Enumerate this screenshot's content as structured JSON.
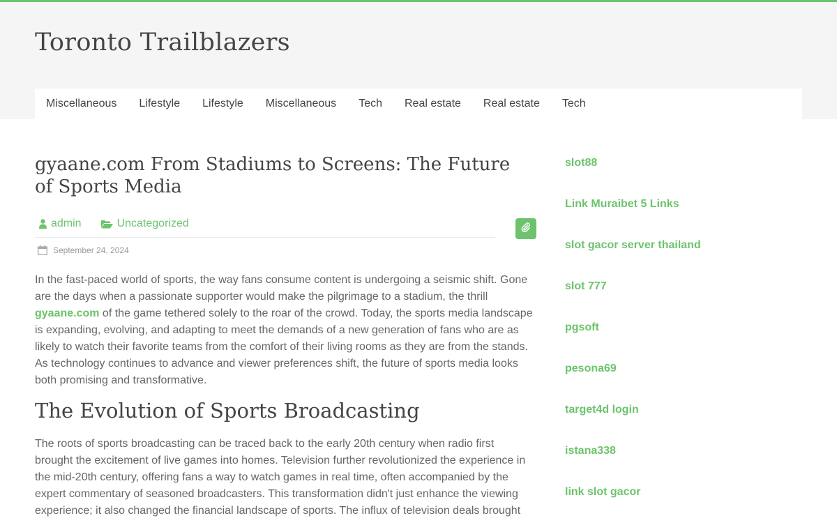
{
  "site": {
    "title": "Toronto Trailblazers"
  },
  "nav": {
    "items": [
      "Miscellaneous",
      "Lifestyle",
      "Lifestyle",
      "Miscellaneous",
      "Tech",
      "Real estate",
      "Real estate",
      "Tech"
    ]
  },
  "post": {
    "title": "gyaane.com From Stadiums to Screens: The Future of Sports Media",
    "author": "admin",
    "category": "Uncategorized",
    "date": "September 24, 2024",
    "para1_before": "In the fast-paced world of sports, the way fans consume content is undergoing a seismic shift. Gone are the days when a passionate supporter would make the pilgrimage to a stadium, the thrill ",
    "para1_link": "gyaane.com",
    "para1_after": " of the game tethered solely to the roar of the crowd. Today, the sports media landscape is expanding, evolving, and  adapting to meet the demands of a new generation of fans who are as likely to watch their favorite teams from the comfort of their living rooms as they are from the stands. As technology continues to advance and viewer preferences shift, the future of sports media looks both promising and transformative.",
    "heading2": "The Evolution of Sports Broadcasting",
    "para2": "The roots of sports broadcasting can be traced back to the early 20th century when radio first brought the excitement of live games into homes. Television further revolutionized the experience in the mid-20th century, offering fans a way to watch games in real time, often accompanied by the expert commentary of seasoned broadcasters. This transformation didn't just enhance the viewing experience; it also changed the financial landscape of sports. The influx of television deals brought"
  },
  "sidebar": {
    "links": [
      "slot88",
      "Link Muraibet 5 Links",
      "slot gacor server thailand",
      "slot 777",
      "pgsoft",
      "pesona69",
      "target4d login",
      "istana338",
      "link slot gacor"
    ]
  },
  "colors": {
    "accent": "#6dc36d",
    "header_bg": "#f5f5f5"
  },
  "icons": {
    "author": "user-icon",
    "category": "folder-open-icon",
    "date": "calendar-icon",
    "format": "paperclip-icon"
  }
}
